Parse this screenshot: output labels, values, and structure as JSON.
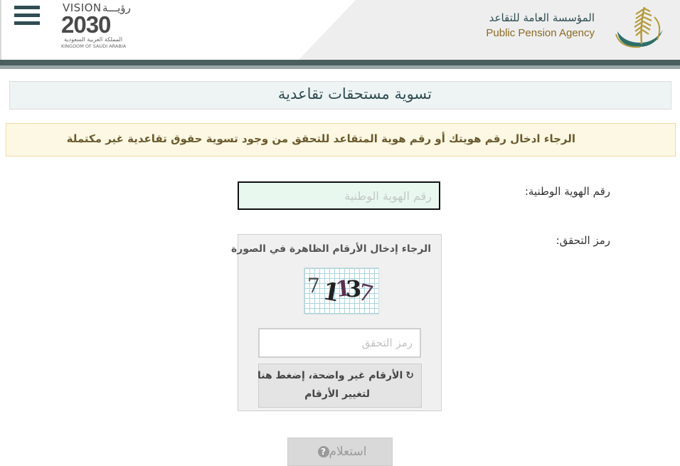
{
  "header": {
    "menu_icon": "hamburger-menu-icon",
    "vision": {
      "title": "VISION",
      "title_ar": "رؤيـــة",
      "year": "2030",
      "kingdom_ar": "المملكة العربية السعودية",
      "kingdom_en": "KINGDOM OF SAUDI ARABIA"
    },
    "agency": {
      "name_ar": "المؤسسة العامة للتقاعد",
      "name_en": "Public Pension Agency"
    },
    "colors": {
      "dark_teal": "#2f4d53",
      "gold": "#8b6a24",
      "band": "#4a5e5e"
    }
  },
  "page": {
    "title": "تسوية مستحقات تقاعدية",
    "notice": "الرجاء ادخال رقم هويتك أو رقم هوية المتقاعد للتحقق من وجود تسوية حقوق تقاعدية غير مكتملة"
  },
  "form": {
    "id_label": "رقم الهوية الوطنية:",
    "id_placeholder": "رقم الهوية الوطنية",
    "captcha_label": "رمز التحقق:",
    "captcha_hint": "الرجاء إدخال الأرقام الظاهرة في الصورة",
    "captcha_digits": [
      "7",
      "1",
      "1",
      "3",
      "7"
    ],
    "captcha_placeholder": "رمز التحقق",
    "refresh_icon": "refresh-icon",
    "refresh_line1": "الأرقام غير واضحة، إضغط هنا",
    "refresh_line2": "لتغيير الأرقام",
    "submit_label": "استعلام",
    "submit_icon": "question-circle-icon"
  }
}
